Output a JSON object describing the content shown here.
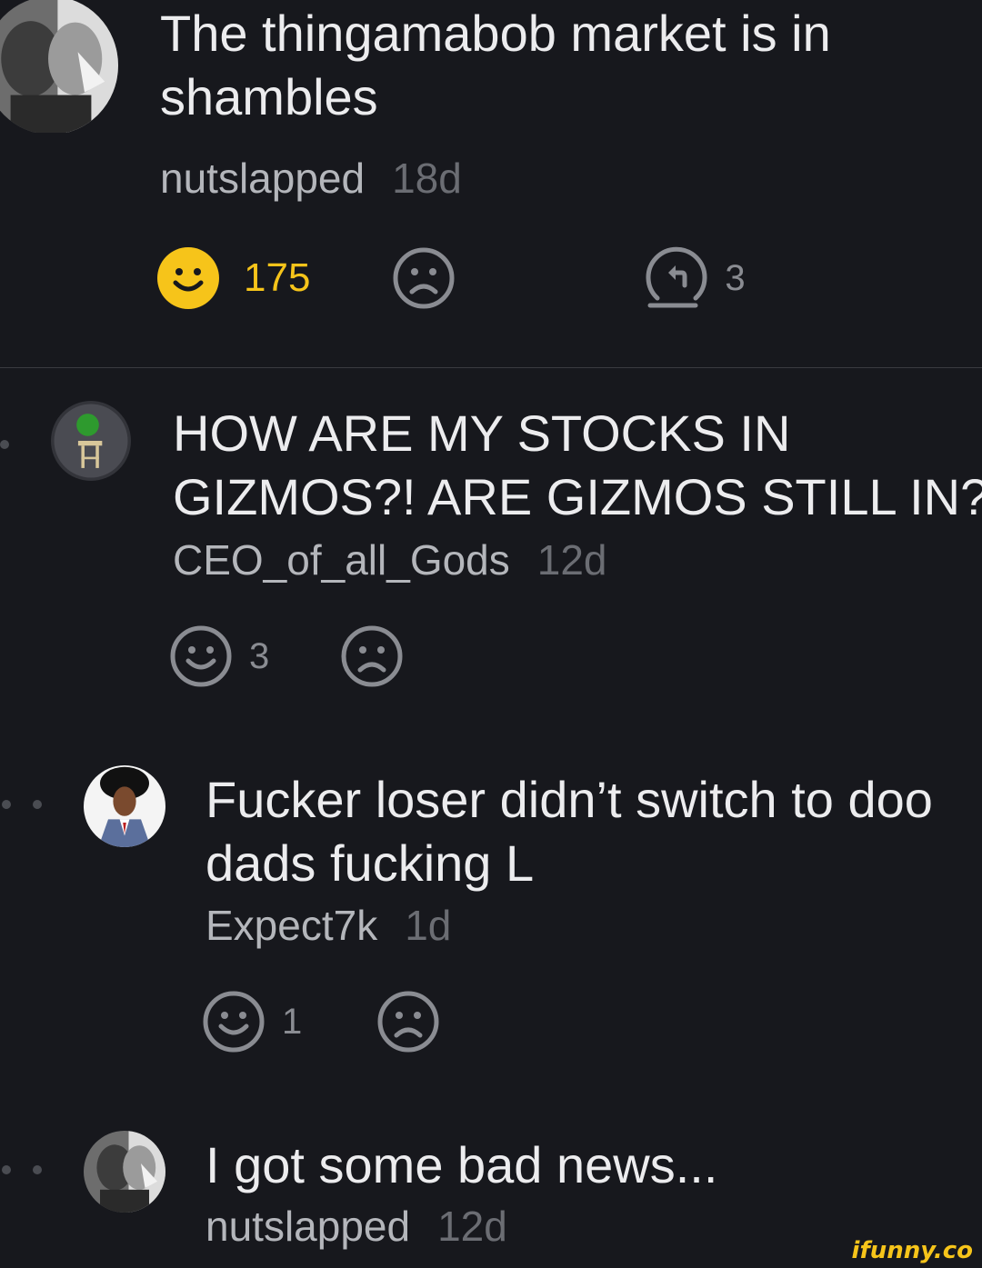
{
  "comments": [
    {
      "text_lines": [
        "The thingamabob market is in",
        "shambles"
      ],
      "author": "nutslapped",
      "age": "18d",
      "smile_count": "175",
      "reply_count": "3"
    },
    {
      "text_lines": [
        "HOW ARE MY STOCKS IN",
        "GIZMOS?! ARE GIZMOS STILL IN?!"
      ],
      "author": "CEO_of_all_Gods",
      "age": "12d",
      "smile_count": "3"
    },
    {
      "text_lines": [
        "Fucker loser didn’t switch to doo",
        "dads fucking L"
      ],
      "author": "Expect7k",
      "age": "1d",
      "smile_count": "1"
    },
    {
      "text_lines": [
        "I got some bad news..."
      ],
      "author": "nutslapped",
      "age": "12d"
    }
  ],
  "icons": {
    "smile_active": "smile-icon",
    "smile": "smile-icon",
    "frown": "frown-icon",
    "reply": "reply-icon"
  },
  "colors": {
    "background": "#17181d",
    "accent": "#f6c41a",
    "icon_gray": "#8a8c92"
  },
  "watermark": "ifunny.co"
}
